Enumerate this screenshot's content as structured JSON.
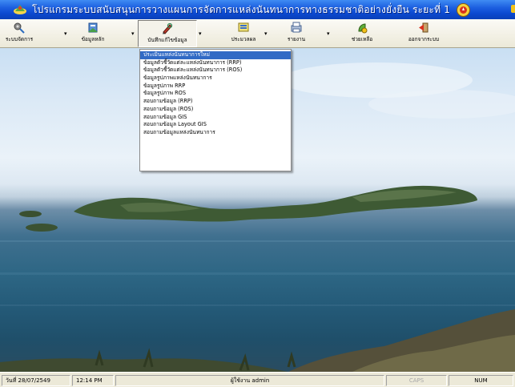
{
  "window": {
    "title": "โปรแกรมระบบสนับสนุนการวางแผนการจัดการแหล่งนันทนาการทางธรรมชาติอย่างยั่งยืน ระยะที่ 1"
  },
  "toolbar": {
    "items": [
      {
        "label": "ระบบจัดการ",
        "icon": "admin-tools-icon"
      },
      {
        "label": "ข้อมูลหลัก",
        "icon": "main-data-icon"
      },
      {
        "label": "บันทึกแก้ไขข้อมูล",
        "icon": "edit-data-icon"
      },
      {
        "label": "ประมวลผล",
        "icon": "process-icon"
      },
      {
        "label": "รายงาน",
        "icon": "report-icon"
      },
      {
        "label": "ช่วยเหลือ",
        "icon": "help-icon"
      },
      {
        "label": "ออกจากระบบ",
        "icon": "logout-icon"
      }
    ]
  },
  "menu": {
    "items": [
      "ประเมินแหล่งนันทนาการใหม่",
      "ข้อมูลตัวชี้วัดแต่ละแหล่งนันทนาการ (RRP)",
      "ข้อมูลตัวชี้วัดแต่ละแหล่งนันทนาการ (ROS)",
      "ข้อมูลรูปภาพแหล่งนันทนาการ",
      "ข้อมูลรูปภาพ RRP",
      "ข้อมูลรูปภาพ ROS",
      "สอบถามข้อมูล (RRP)",
      "สอบถามข้อมูล (ROS)",
      "สอบถามข้อมูล GIS",
      "สอบถามข้อมูล Layout GIS",
      "สอบถามข้อมูลแหล่งนันทนาการ"
    ],
    "selected_index": 0
  },
  "status": {
    "date": "วันที่ 28/07/2549",
    "time": "12:14 PM",
    "user": "ผู้ใช้งาน admin",
    "caps": "CAPS",
    "num": "NUM"
  },
  "colors": {
    "titlebar": "#0b49d0",
    "menu_selected": "#316ac5",
    "toolbar_bg": "#ece9d8"
  }
}
